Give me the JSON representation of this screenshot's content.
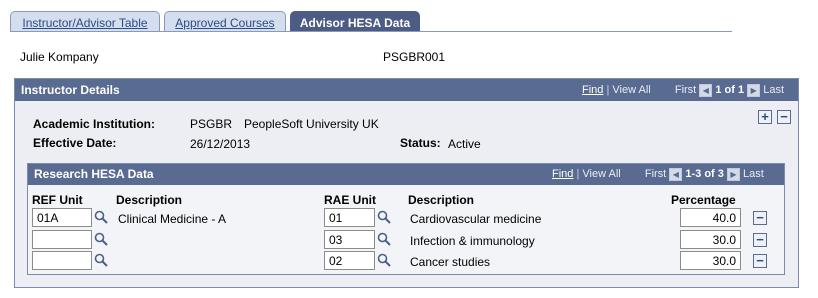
{
  "tabs": [
    {
      "label": "Instructor/Advisor Table"
    },
    {
      "label": "Approved Courses"
    },
    {
      "label": "Advisor HESA Data"
    }
  ],
  "person": {
    "name": "Julie Kompany",
    "id": "PSGBR001"
  },
  "instructor_details": {
    "title": "Instructor Details",
    "nav": {
      "find": "Find",
      "view_all": "View All",
      "first": "First",
      "count": "1 of 1",
      "last": "Last"
    },
    "academic_institution_label": "Academic Institution:",
    "academic_institution_code": "PSGBR",
    "academic_institution_name": "PeopleSoft University UK",
    "effective_date_label": "Effective Date:",
    "effective_date": "26/12/2013",
    "status_label": "Status:",
    "status": "Active"
  },
  "research": {
    "title": "Research HESA Data",
    "nav": {
      "find": "Find",
      "view_all": "View All",
      "first": "First",
      "count": "1-3 of 3",
      "last": "Last"
    },
    "columns": {
      "ref_unit": "REF Unit",
      "description": "Description",
      "rae_unit": "RAE Unit",
      "description2": "Description",
      "percentage": "Percentage"
    },
    "rows": [
      {
        "ref_unit": "01A",
        "ref_desc": "Clinical Medicine - A",
        "rae_unit": "01",
        "rae_desc": "Cardiovascular medicine",
        "percentage": "40.0"
      },
      {
        "ref_unit": "",
        "ref_desc": "",
        "rae_unit": "03",
        "rae_desc": "Infection & immunology",
        "percentage": "30.0"
      },
      {
        "ref_unit": "",
        "ref_desc": "",
        "rae_unit": "02",
        "rae_desc": "Cancer studies",
        "percentage": "30.0"
      }
    ]
  },
  "icons": {
    "lookup": "magnifier-icon",
    "add": "plus-icon",
    "delete": "minus-icon"
  }
}
